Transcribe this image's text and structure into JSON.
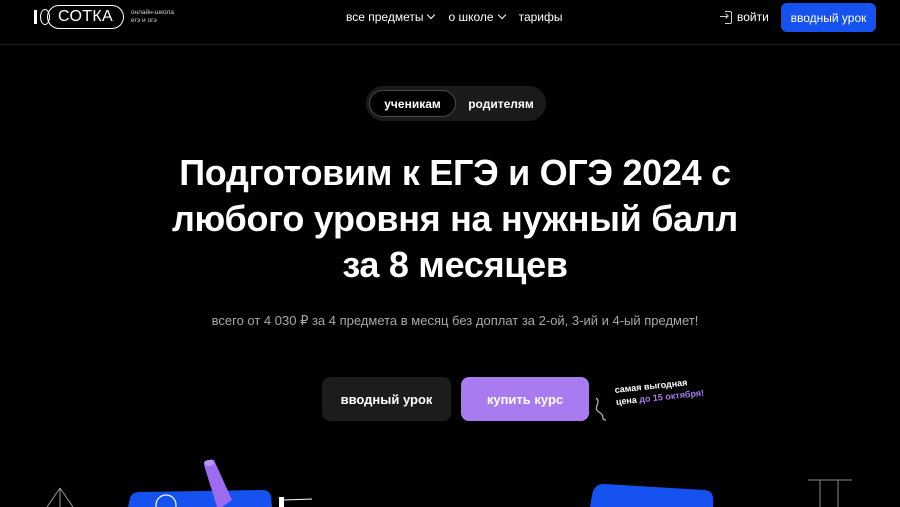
{
  "header": {
    "logo": {
      "mark": "СОТКА",
      "sub_line1": "онлайн-школа",
      "sub_line2": "егэ и огэ"
    },
    "nav": [
      {
        "label": "все предметы",
        "has_dropdown": true,
        "icon": "chevron-down-icon"
      },
      {
        "label": "о школе",
        "has_dropdown": true,
        "icon": "chevron-down-icon"
      },
      {
        "label": "тарифы",
        "has_dropdown": false
      }
    ],
    "login_label": "войти",
    "login_icon": "login-icon",
    "cta_label": "вводный урок"
  },
  "audience_toggle": {
    "options": [
      "ученикам",
      "родителям"
    ],
    "selected": "ученикам"
  },
  "hero": {
    "title_line1": "Подготовим к ЕГЭ и ОГЭ 2024 с",
    "title_line2": "любого уровня на нужный балл",
    "title_line3": "за 8 месяцев",
    "subtitle": "всего от 4 030 ₽ за 4 предмета в месяц без доплат за 2-ой, 3-ий и 4-ый предмет!",
    "primary_button": "вводный урок",
    "buy_button": "купить курс",
    "promo_line1": "самая выгодная",
    "promo_line2_prefix": "цена ",
    "promo_line2_accent": "до 15 октября!"
  },
  "colors": {
    "background": "#000000",
    "accent_blue": "#1552f0",
    "accent_purple": "#a97bf0",
    "dark_button": "#1c1c1c",
    "muted_text": "#a8a8a8"
  }
}
